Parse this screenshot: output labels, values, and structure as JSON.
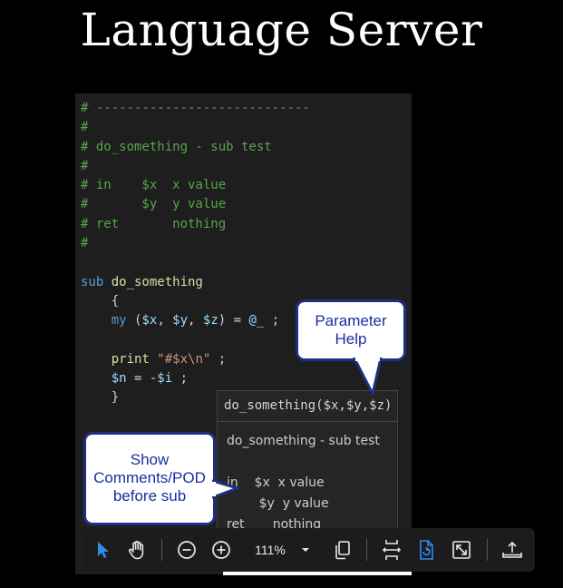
{
  "title": "Language Server",
  "code_lines": [
    {
      "cls": "cm",
      "text": "# ----------------------------"
    },
    {
      "cls": "cm",
      "text": "#"
    },
    {
      "cls": "cm",
      "text": "# do_something - sub test"
    },
    {
      "cls": "cm",
      "text": "#"
    },
    {
      "cls": "cm",
      "text": "# in    $x  x value"
    },
    {
      "cls": "cm",
      "text": "#       $y  y value"
    },
    {
      "cls": "cm",
      "text": "# ret       nothing"
    },
    {
      "cls": "cm",
      "text": "#"
    },
    {
      "cls": "pl",
      "text": ""
    },
    {
      "parts": [
        {
          "cls": "kw",
          "text": "sub "
        },
        {
          "cls": "fn",
          "text": "do_something"
        }
      ]
    },
    {
      "parts": [
        {
          "cls": "pl",
          "text": "    {"
        }
      ]
    },
    {
      "parts": [
        {
          "cls": "kw",
          "text": "    my "
        },
        {
          "cls": "pl",
          "text": "("
        },
        {
          "cls": "vr",
          "text": "$x"
        },
        {
          "cls": "pl",
          "text": ", "
        },
        {
          "cls": "vr",
          "text": "$y"
        },
        {
          "cls": "pl",
          "text": ", "
        },
        {
          "cls": "vr",
          "text": "$z"
        },
        {
          "cls": "pl",
          "text": ") = "
        },
        {
          "cls": "vr",
          "text": "@_"
        },
        {
          "cls": "pl",
          "text": " ;"
        }
      ]
    },
    {
      "parts": [
        {
          "cls": "pl",
          "text": ""
        }
      ]
    },
    {
      "parts": [
        {
          "cls": "fn",
          "text": "    print "
        },
        {
          "cls": "st",
          "text": "\"#$x\\n\""
        },
        {
          "cls": "pl",
          "text": " ;"
        }
      ]
    },
    {
      "parts": [
        {
          "cls": "vr",
          "text": "    $n"
        },
        {
          "cls": "pl",
          "text": " = -"
        },
        {
          "cls": "vr",
          "text": "$i"
        },
        {
          "cls": "pl",
          "text": " ;"
        }
      ]
    },
    {
      "parts": [
        {
          "cls": "pl",
          "text": "    }"
        }
      ]
    }
  ],
  "hover": {
    "signature": "do_something($x,$y,$z)",
    "doc_lines": [
      "do_something - sub test",
      "",
      "in    $x  x value",
      "        $y  y value",
      "ret       nothing"
    ]
  },
  "callouts": {
    "parameter_help": [
      "Parameter",
      "Help"
    ],
    "show_comments": [
      "Show",
      "Comments/POD",
      "before sub"
    ]
  },
  "toolbar": {
    "zoom": "111%",
    "icons": [
      "select-pointer-icon",
      "hand-pan-icon",
      "zoom-out-icon",
      "zoom-in-icon",
      "zoom-dropdown-icon",
      "page-view-icon",
      "fit-width-icon",
      "rotate-icon",
      "fullscreen-icon",
      "share-icon"
    ]
  }
}
